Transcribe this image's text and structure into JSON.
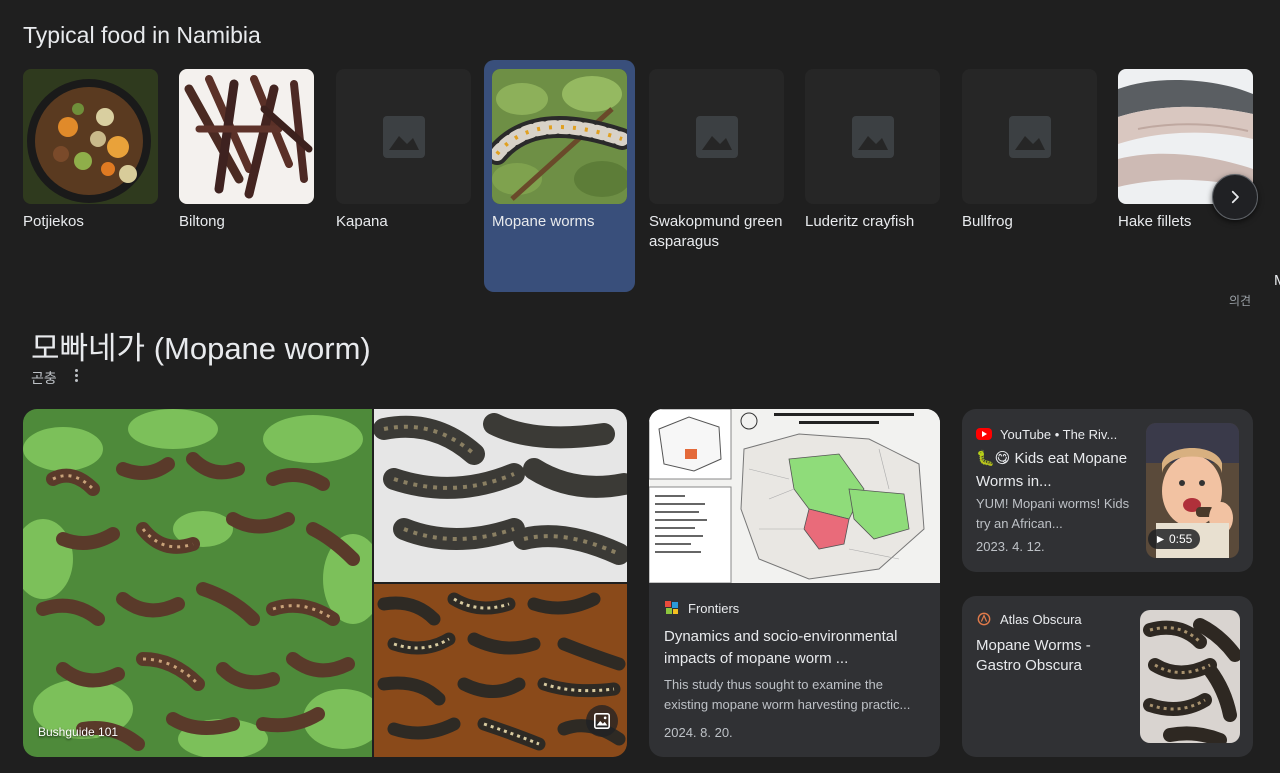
{
  "carousel": {
    "title": "Typical food in Namibia",
    "items": [
      {
        "label": "Potjiekos"
      },
      {
        "label": "Biltong"
      },
      {
        "label": "Kapana"
      },
      {
        "label": "Mopane worms"
      },
      {
        "label": "Swakopmund green asparagus"
      },
      {
        "label": "Luderitz crayfish"
      },
      {
        "label": "Bullfrog"
      },
      {
        "label": "Hake fillets"
      }
    ],
    "cut_label": "M",
    "feedback": "의견"
  },
  "entity": {
    "title": "모빠네가 (Mopane worm)",
    "subtitle": "곤충"
  },
  "gallery": {
    "caption": "Bushguide 101"
  },
  "results": {
    "frontiers": {
      "source": "Frontiers",
      "title": "Dynamics and socio-environmental impacts of mopane worm ...",
      "desc": "This study thus sought to examine the existing mopane worm harvesting practic...",
      "date": "2024. 8. 20."
    },
    "youtube": {
      "source": "YouTube • The Riv...",
      "title": "🐛😋 Kids eat Mopane Worms in...",
      "desc": "YUM! Mopani worms! Kids try an African...",
      "date": "2023. 4. 12.",
      "duration": "0:55"
    },
    "atlas": {
      "source": "Atlas Obscura",
      "title": "Mopane Worms - Gastro Obscura"
    }
  },
  "colors": {
    "background": "#1f1f1f",
    "card": "#303134",
    "selected": "#394f7b",
    "youtube_red": "#ff0000"
  }
}
